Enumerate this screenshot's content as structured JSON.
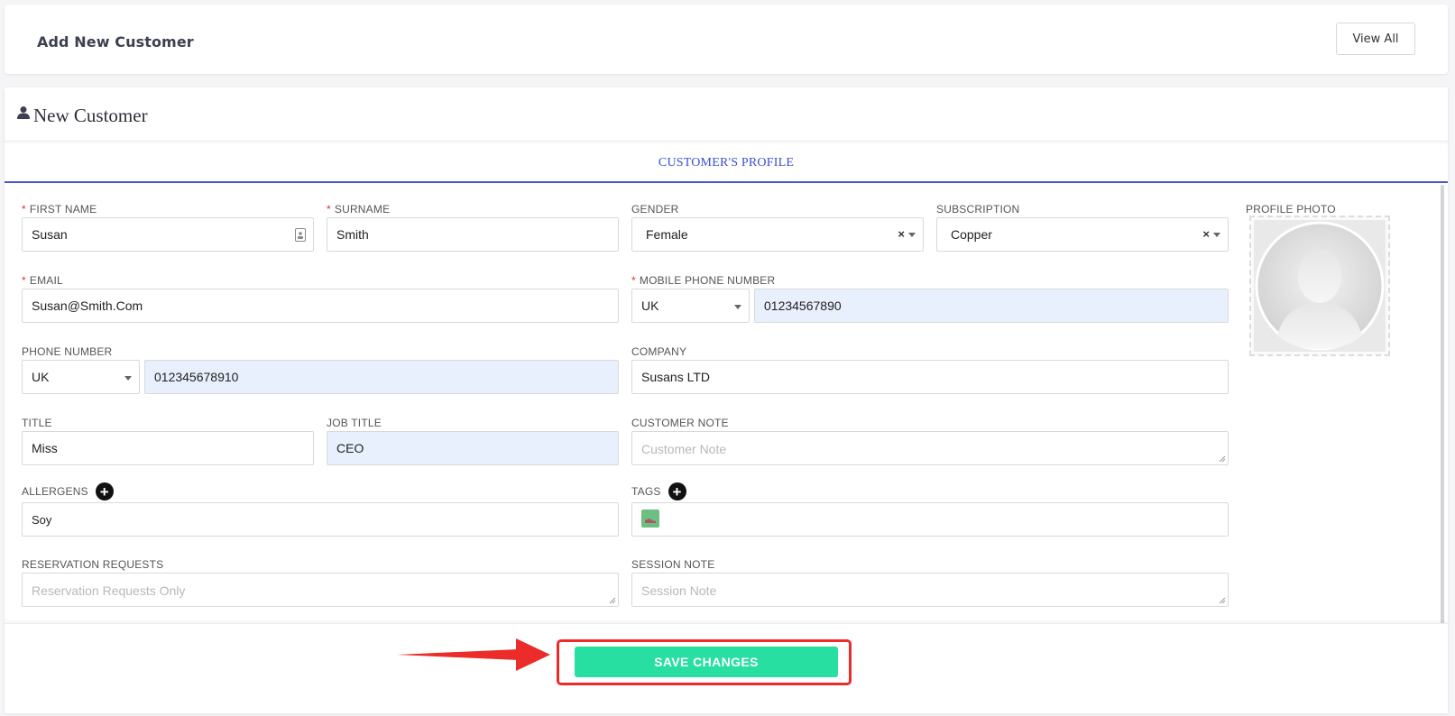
{
  "header": {
    "title": "Add New Customer",
    "view_all_label": "View All"
  },
  "main": {
    "title": "New Customer",
    "tab_label": "CUSTOMER'S PROFILE"
  },
  "form": {
    "first_name": {
      "label": "FIRST NAME",
      "value": "Susan"
    },
    "surname": {
      "label": "SURNAME",
      "value": "Smith"
    },
    "gender": {
      "label": "GENDER",
      "value": "Female"
    },
    "subscription": {
      "label": "SUBSCRIPTION",
      "value": "Copper"
    },
    "profile_photo": {
      "label": "PROFILE PHOTO"
    },
    "email": {
      "label": "EMAIL",
      "value": "Susan@Smith.Com"
    },
    "mobile_phone": {
      "label": "MOBILE PHONE NUMBER",
      "country": "UK",
      "value": "01234567890"
    },
    "phone": {
      "label": "PHONE NUMBER",
      "country": "UK",
      "value": "012345678910"
    },
    "company": {
      "label": "COMPANY",
      "value": "Susans LTD"
    },
    "title": {
      "label": "TITLE",
      "value": "Miss"
    },
    "job_title": {
      "label": "JOB TITLE",
      "value": "CEO"
    },
    "customer_note": {
      "label": "CUSTOMER NOTE",
      "placeholder": "Customer Note"
    },
    "allergens": {
      "label": "ALLERGENS",
      "value": "Soy"
    },
    "tags": {
      "label": "TAGS"
    },
    "reservation_requests": {
      "label": "RESERVATION REQUESTS",
      "placeholder": "Reservation Requests Only"
    },
    "session_note": {
      "label": "SESSION NOTE",
      "placeholder": "Session Note"
    },
    "required_marker": "*",
    "clear_glyph": "×",
    "plus_glyph": "+"
  },
  "footer": {
    "save_label": "SAVE CHANGES"
  },
  "colors": {
    "accent": "#4b55c8",
    "save_button": "#27dfa0",
    "highlight": "#ec2b2b",
    "tinted_input": "#e8f0fd"
  }
}
